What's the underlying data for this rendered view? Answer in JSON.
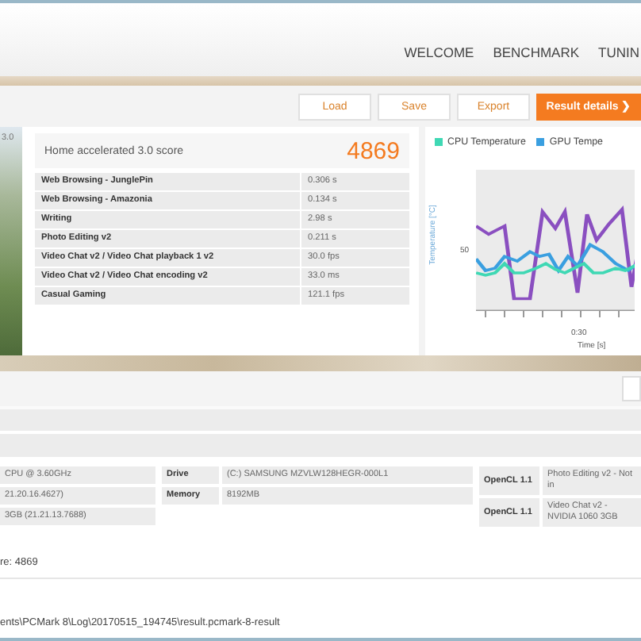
{
  "header": {
    "nav": [
      {
        "label": "WELCOME"
      },
      {
        "label": "BENCHMARK"
      },
      {
        "label": "TUNIN"
      }
    ]
  },
  "toolbar": {
    "buttons": [
      {
        "label": "Load",
        "kind": "plain"
      },
      {
        "label": "Save",
        "kind": "plain"
      },
      {
        "label": "Export",
        "kind": "plain"
      },
      {
        "label": "Result details",
        "kind": "primary",
        "icon": "❯"
      }
    ]
  },
  "side_panel": {
    "label": "3.0"
  },
  "score": {
    "label": "Home accelerated 3.0 score",
    "value": "4869"
  },
  "results": [
    {
      "name": "Web Browsing - JunglePin",
      "value": "0.306 s"
    },
    {
      "name": "Web Browsing - Amazonia",
      "value": "0.134 s"
    },
    {
      "name": "Writing",
      "value": "2.98 s"
    },
    {
      "name": "Photo Editing v2",
      "value": "0.211 s"
    },
    {
      "name": "Video Chat v2 / Video Chat playback 1 v2",
      "value": "30.0 fps"
    },
    {
      "name": "Video Chat v2 / Video Chat encoding v2",
      "value": "33.0 ms"
    },
    {
      "name": "Casual Gaming",
      "value": "121.1 fps"
    }
  ],
  "chart": {
    "legend": [
      {
        "name": "CPU Temperature",
        "color": "#3fd8b4"
      },
      {
        "name": "GPU Tempe",
        "color": "#3a9fe0"
      }
    ],
    "ylabel": "Temperature [°C]",
    "ytick": "50",
    "xtick": "0:30",
    "xlabel": "Time [s]"
  },
  "system_info": {
    "column_1": [
      "CPU @ 3.60GHz",
      "21.20.16.4627)",
      "3GB (21.21.13.7688)"
    ],
    "column_2": [
      {
        "label": "Drive",
        "value": "(C:) SAMSUNG MZVLW128HEGR-000L1"
      },
      {
        "label": "Memory",
        "value": "8192MB"
      }
    ],
    "column_3": [
      {
        "label": "OpenCL 1.1",
        "value": "Photo Editing v2 - Not in"
      },
      {
        "label": "OpenCL 1.1",
        "value": "Video Chat v2 - NVIDIA 1060 3GB"
      }
    ]
  },
  "score_line": "re: 4869",
  "file_path": "ents\\PCMark 8\\Log\\20170515_194745\\result.pcmark-8-result"
}
